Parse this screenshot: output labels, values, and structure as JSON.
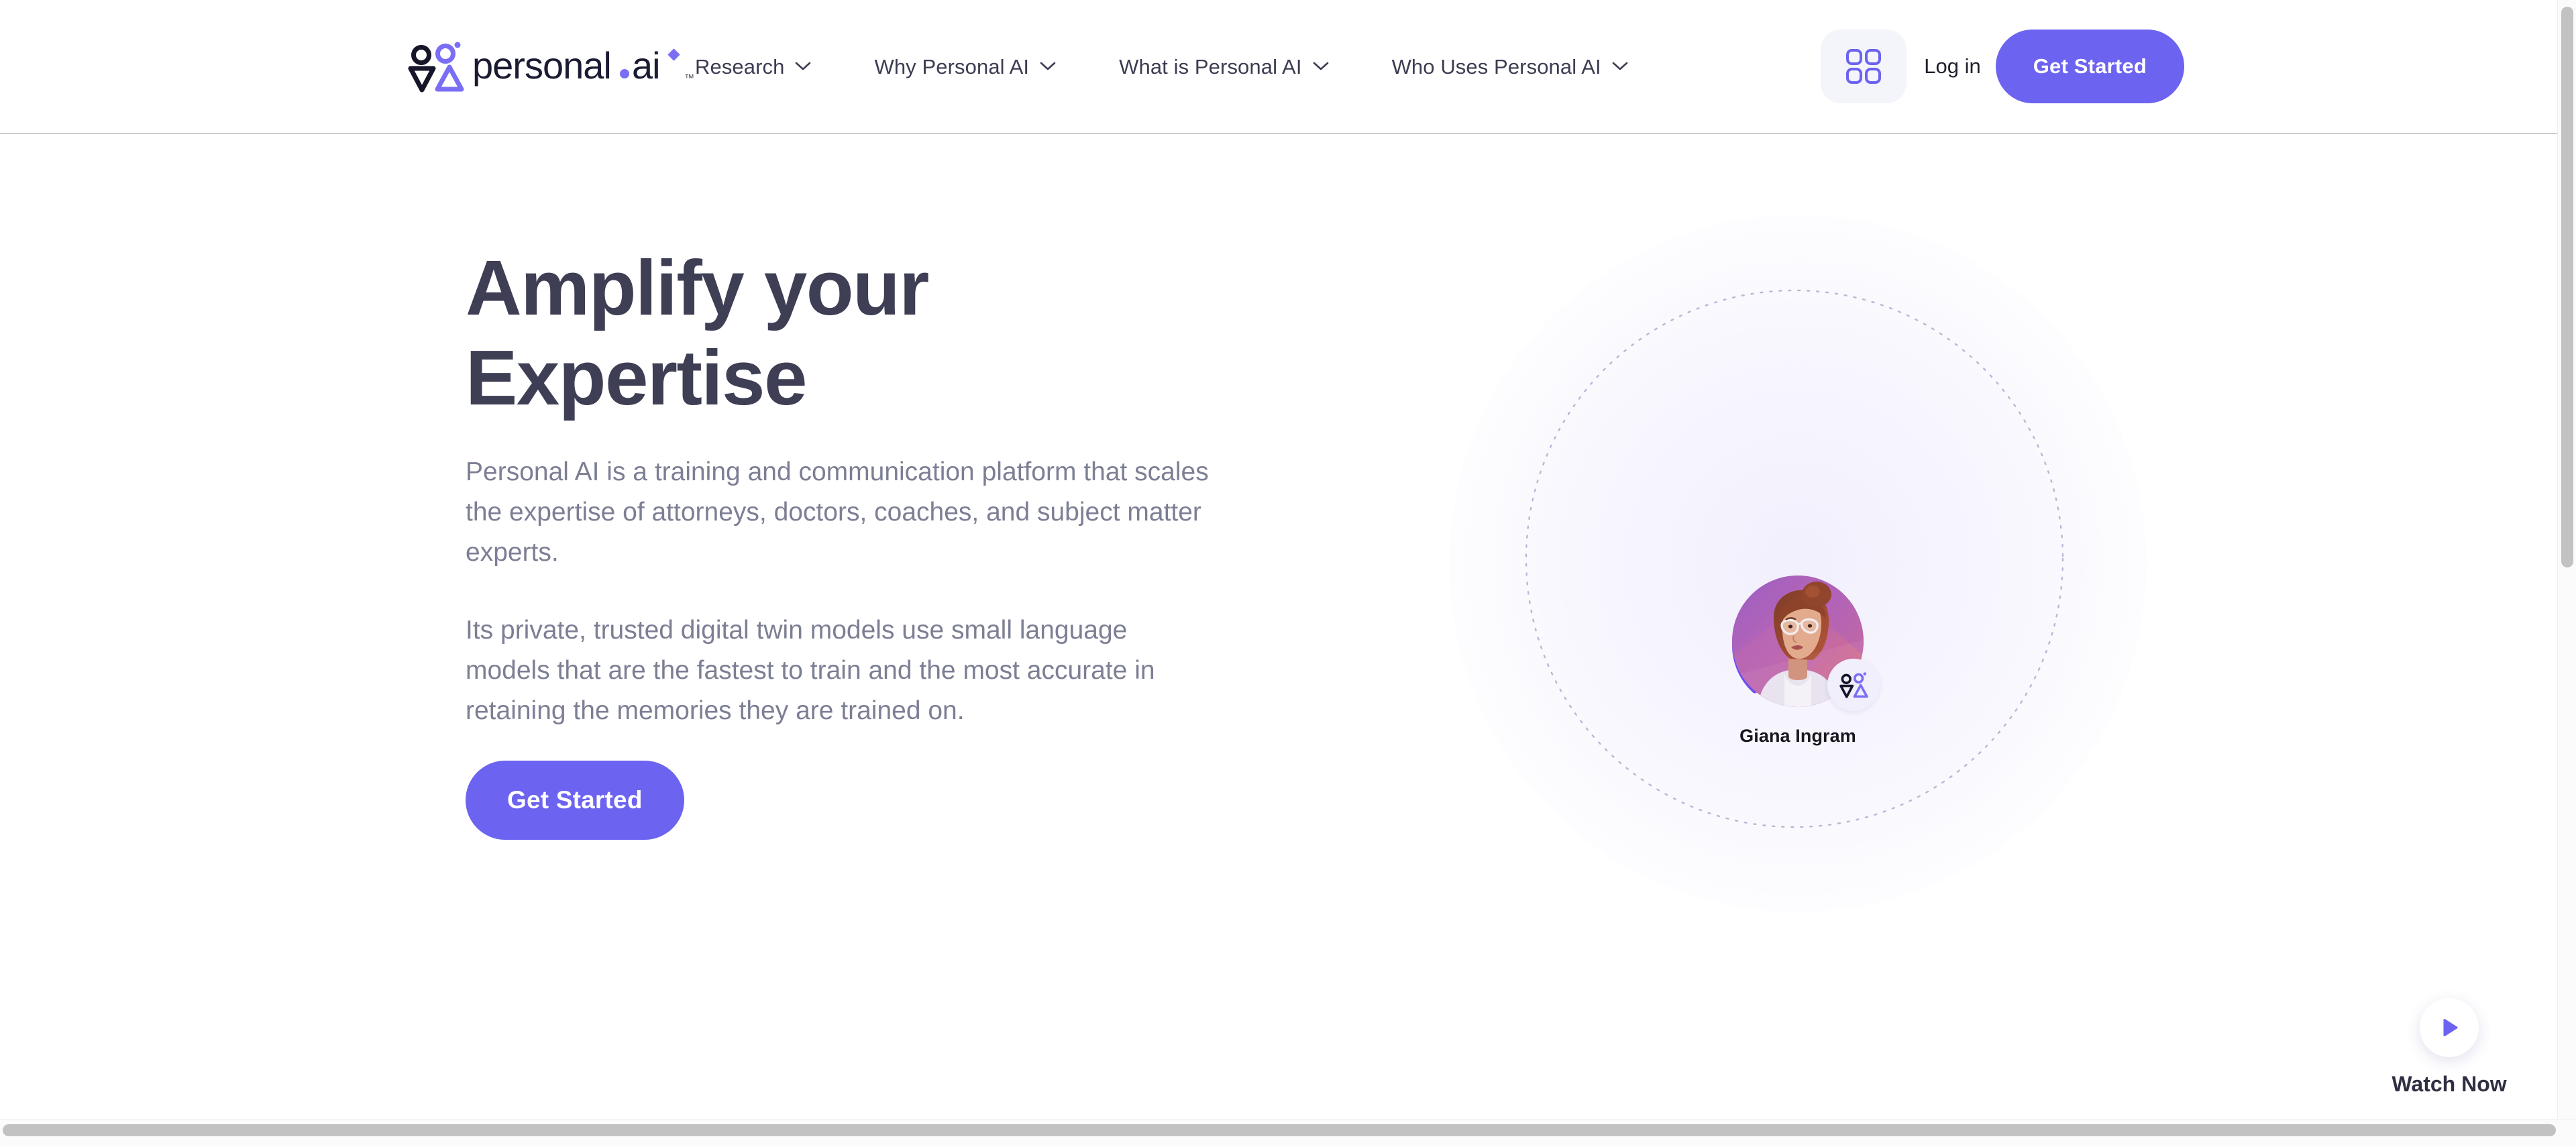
{
  "brand": {
    "wordmark": "personal.ai",
    "trademark": "™",
    "logo_icon": "personal-ai-logo-mark",
    "accent_color": "#6c63f0",
    "dark_color": "#21212e"
  },
  "header": {
    "nav": [
      {
        "label": "Research",
        "icon": "chevron-down-icon"
      },
      {
        "label": "Why Personal AI",
        "icon": "chevron-down-icon"
      },
      {
        "label": "What is Personal AI",
        "icon": "chevron-down-icon"
      },
      {
        "label": "Who Uses Personal AI",
        "icon": "chevron-down-icon"
      }
    ],
    "apps_icon": "grid-apps-icon",
    "login_label": "Log in",
    "get_started_label": "Get Started"
  },
  "hero": {
    "title": "Amplify your\nExpertise",
    "paragraphs": [
      "Personal AI is a training and communication platform that scales the expertise of attorneys, doctors, coaches, and subject matter experts.",
      "Its private, trusted digital twin models use small language models that are the fastest to train and the most accurate in retaining the memories they are trained on."
    ],
    "cta_label": "Get Started",
    "visual": {
      "avatar_name": "Giana Ingram",
      "avatar_image": "woman-with-glasses-portrait",
      "badge_icon": "personal-ai-logo-mark",
      "ring_arc_colors": [
        "#7a5cf0",
        "#a96ae8"
      ],
      "dotted_ring_color": "#b9b6d6",
      "halo_color": "#eeebfc"
    }
  },
  "watch": {
    "label": "Watch Now",
    "icon": "play-icon",
    "icon_color": "#6c63f0"
  },
  "scrollbars": {
    "vertical_thumb": "vertical-scroll-thumb",
    "horizontal_thumb": "horizontal-scroll-thumb"
  }
}
